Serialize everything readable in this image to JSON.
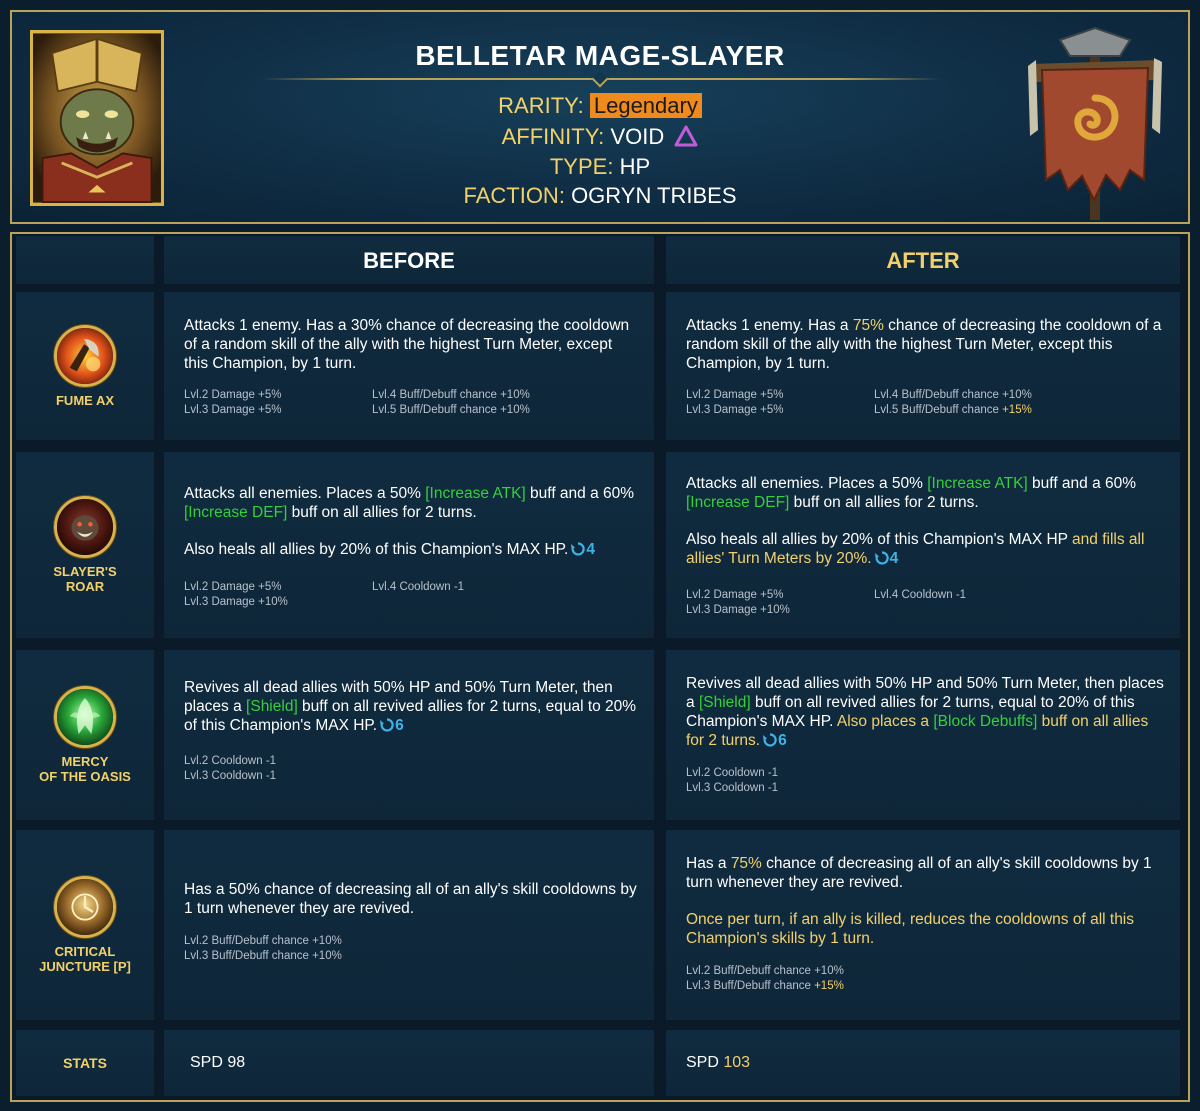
{
  "header": {
    "title": "BELLETAR MAGE-SLAYER",
    "rarity_label": "RARITY:",
    "rarity_value": "Legendary",
    "affinity_label": "AFFINITY:",
    "affinity_value": "VOID",
    "type_label": "TYPE:",
    "type_value": "HP",
    "faction_label": "FACTION:",
    "faction_value": "OGRYN TRIBES",
    "rarity_color": "#f08a1c",
    "affinity_icon": "void-triangle-icon",
    "accent_color": "#f2d16b",
    "frame_color": "#b9a25a"
  },
  "columns": {
    "before": "BEFORE",
    "after": "AFTER"
  },
  "skills": [
    {
      "name_line1": "FUME AX",
      "name_line2": "",
      "icon": "fume-ax-icon",
      "before": {
        "desc": "Attacks 1 enemy. Has a 30% chance of decreasing the cooldown of a random skill of the ally with the highest Turn Meter, except this Champion, by 1 turn.",
        "upgrades": [
          "Lvl.2 Damage +5%",
          "Lvl.4 Buff/Debuff chance +10%",
          "Lvl.3 Damage +5%",
          "Lvl.5 Buff/Debuff chance +10%"
        ]
      },
      "after": {
        "desc_a": "Attacks 1 enemy. Has a ",
        "desc_hl": "75%",
        "desc_b": " chance of decreasing the cooldown of a random skill of the ally with the highest Turn Meter, except this Champion, by 1 turn.",
        "upgrades": [
          "Lvl.2 Damage +5%",
          "Lvl.4 Buff/Debuff chance +10%",
          "Lvl.3 Damage +5%",
          "Lvl.5 Buff/Debuff chance "
        ],
        "upgrade_hl": "+15%"
      }
    },
    {
      "name_line1": "SLAYER'S",
      "name_line2": "ROAR",
      "icon": "slayers-roar-icon",
      "before": {
        "p1_a": "Attacks all enemies. Places a 50% ",
        "p1_buff1": "[Increase ATK]",
        "p1_b": " buff and a 60% ",
        "p1_buff2": "[Increase DEF]",
        "p1_c": " buff on all allies for 2 turns.",
        "p2": "Also heals all allies by 20% of this Champion's MAX HP.",
        "cooldown": "4",
        "upgrades": [
          "Lvl.2 Damage +5%",
          "Lvl.4 Cooldown -1",
          "Lvl.3 Damage +10%",
          ""
        ]
      },
      "after": {
        "p1_a": "Attacks all enemies. Places a 50% ",
        "p1_buff1": "[Increase ATK]",
        "p1_b": " buff and a 60% ",
        "p1_buff2": "[Increase DEF]",
        "p1_c": " buff on all allies for 2 turns.",
        "p2_a": "Also heals all allies by 20% of this Champion's MAX HP",
        "p2_hl": " and fills all allies' Turn Meters by 20%.",
        "cooldown": "4",
        "upgrades": [
          "Lvl.2 Damage +5%",
          "Lvl.4 Cooldown -1",
          "Lvl.3 Damage +10%",
          ""
        ]
      }
    },
    {
      "name_line1": "MERCY",
      "name_line2": "OF THE OASIS",
      "icon": "mercy-of-the-oasis-icon",
      "before": {
        "p1_a": "Revives all dead allies with 50% HP and 50% Turn Meter, then places a ",
        "p1_buff1": "[Shield]",
        "p1_b": " buff on all revived allies for 2 turns, equal to 20% of this Champion's MAX HP.",
        "cooldown": "6",
        "upgrades": [
          "Lvl.2 Cooldown -1",
          "Lvl.3 Cooldown -1"
        ]
      },
      "after": {
        "p1_a": "Revives all dead allies with 50% HP and 50% Turn Meter, then places a ",
        "p1_buff1": "[Shield]",
        "p1_b": " buff on all revived allies for 2 turns, equal to 20% of this Champion's MAX HP. ",
        "p1_hl_a": "Also places a ",
        "p1_buff2": "[Block Debuffs]",
        "p1_hl_b": " buff on all allies for 2 turns.",
        "cooldown": "6",
        "upgrades": [
          "Lvl.2 Cooldown -1",
          "Lvl.3 Cooldown -1"
        ]
      }
    },
    {
      "name_line1": "CRITICAL",
      "name_line2": "JUNCTURE [P]",
      "icon": "critical-juncture-icon",
      "before": {
        "desc": "Has a 50% chance of decreasing all of an ally's skill cooldowns by 1 turn whenever they are revived.",
        "upgrades": [
          "Lvl.2 Buff/Debuff chance +10%",
          "Lvl.3 Buff/Debuff chance +10%"
        ]
      },
      "after": {
        "p1_a": "Has a ",
        "p1_hl": "75%",
        "p1_b": " chance of decreasing all of an ally's skill cooldowns by 1 turn whenever they are revived.",
        "p2": "Once per turn, if an ally is killed, reduces the cooldowns of all this Champion's skills by 1 turn.",
        "upgrades": [
          "Lvl.2 Buff/Debuff chance +10%",
          "Lvl.3 Buff/Debuff chance "
        ],
        "upgrade_hl": "+15%"
      }
    }
  ],
  "stats": {
    "label": "STATS",
    "before": "SPD 98",
    "after_label": "SPD ",
    "after_value": "103"
  },
  "colors": {
    "buff_green": "#35d03a",
    "cooldown_blue": "#3fb3e6",
    "highlight_yellow": "#f2d16b",
    "panel": "#102b40",
    "background": "#0b1e2e"
  }
}
